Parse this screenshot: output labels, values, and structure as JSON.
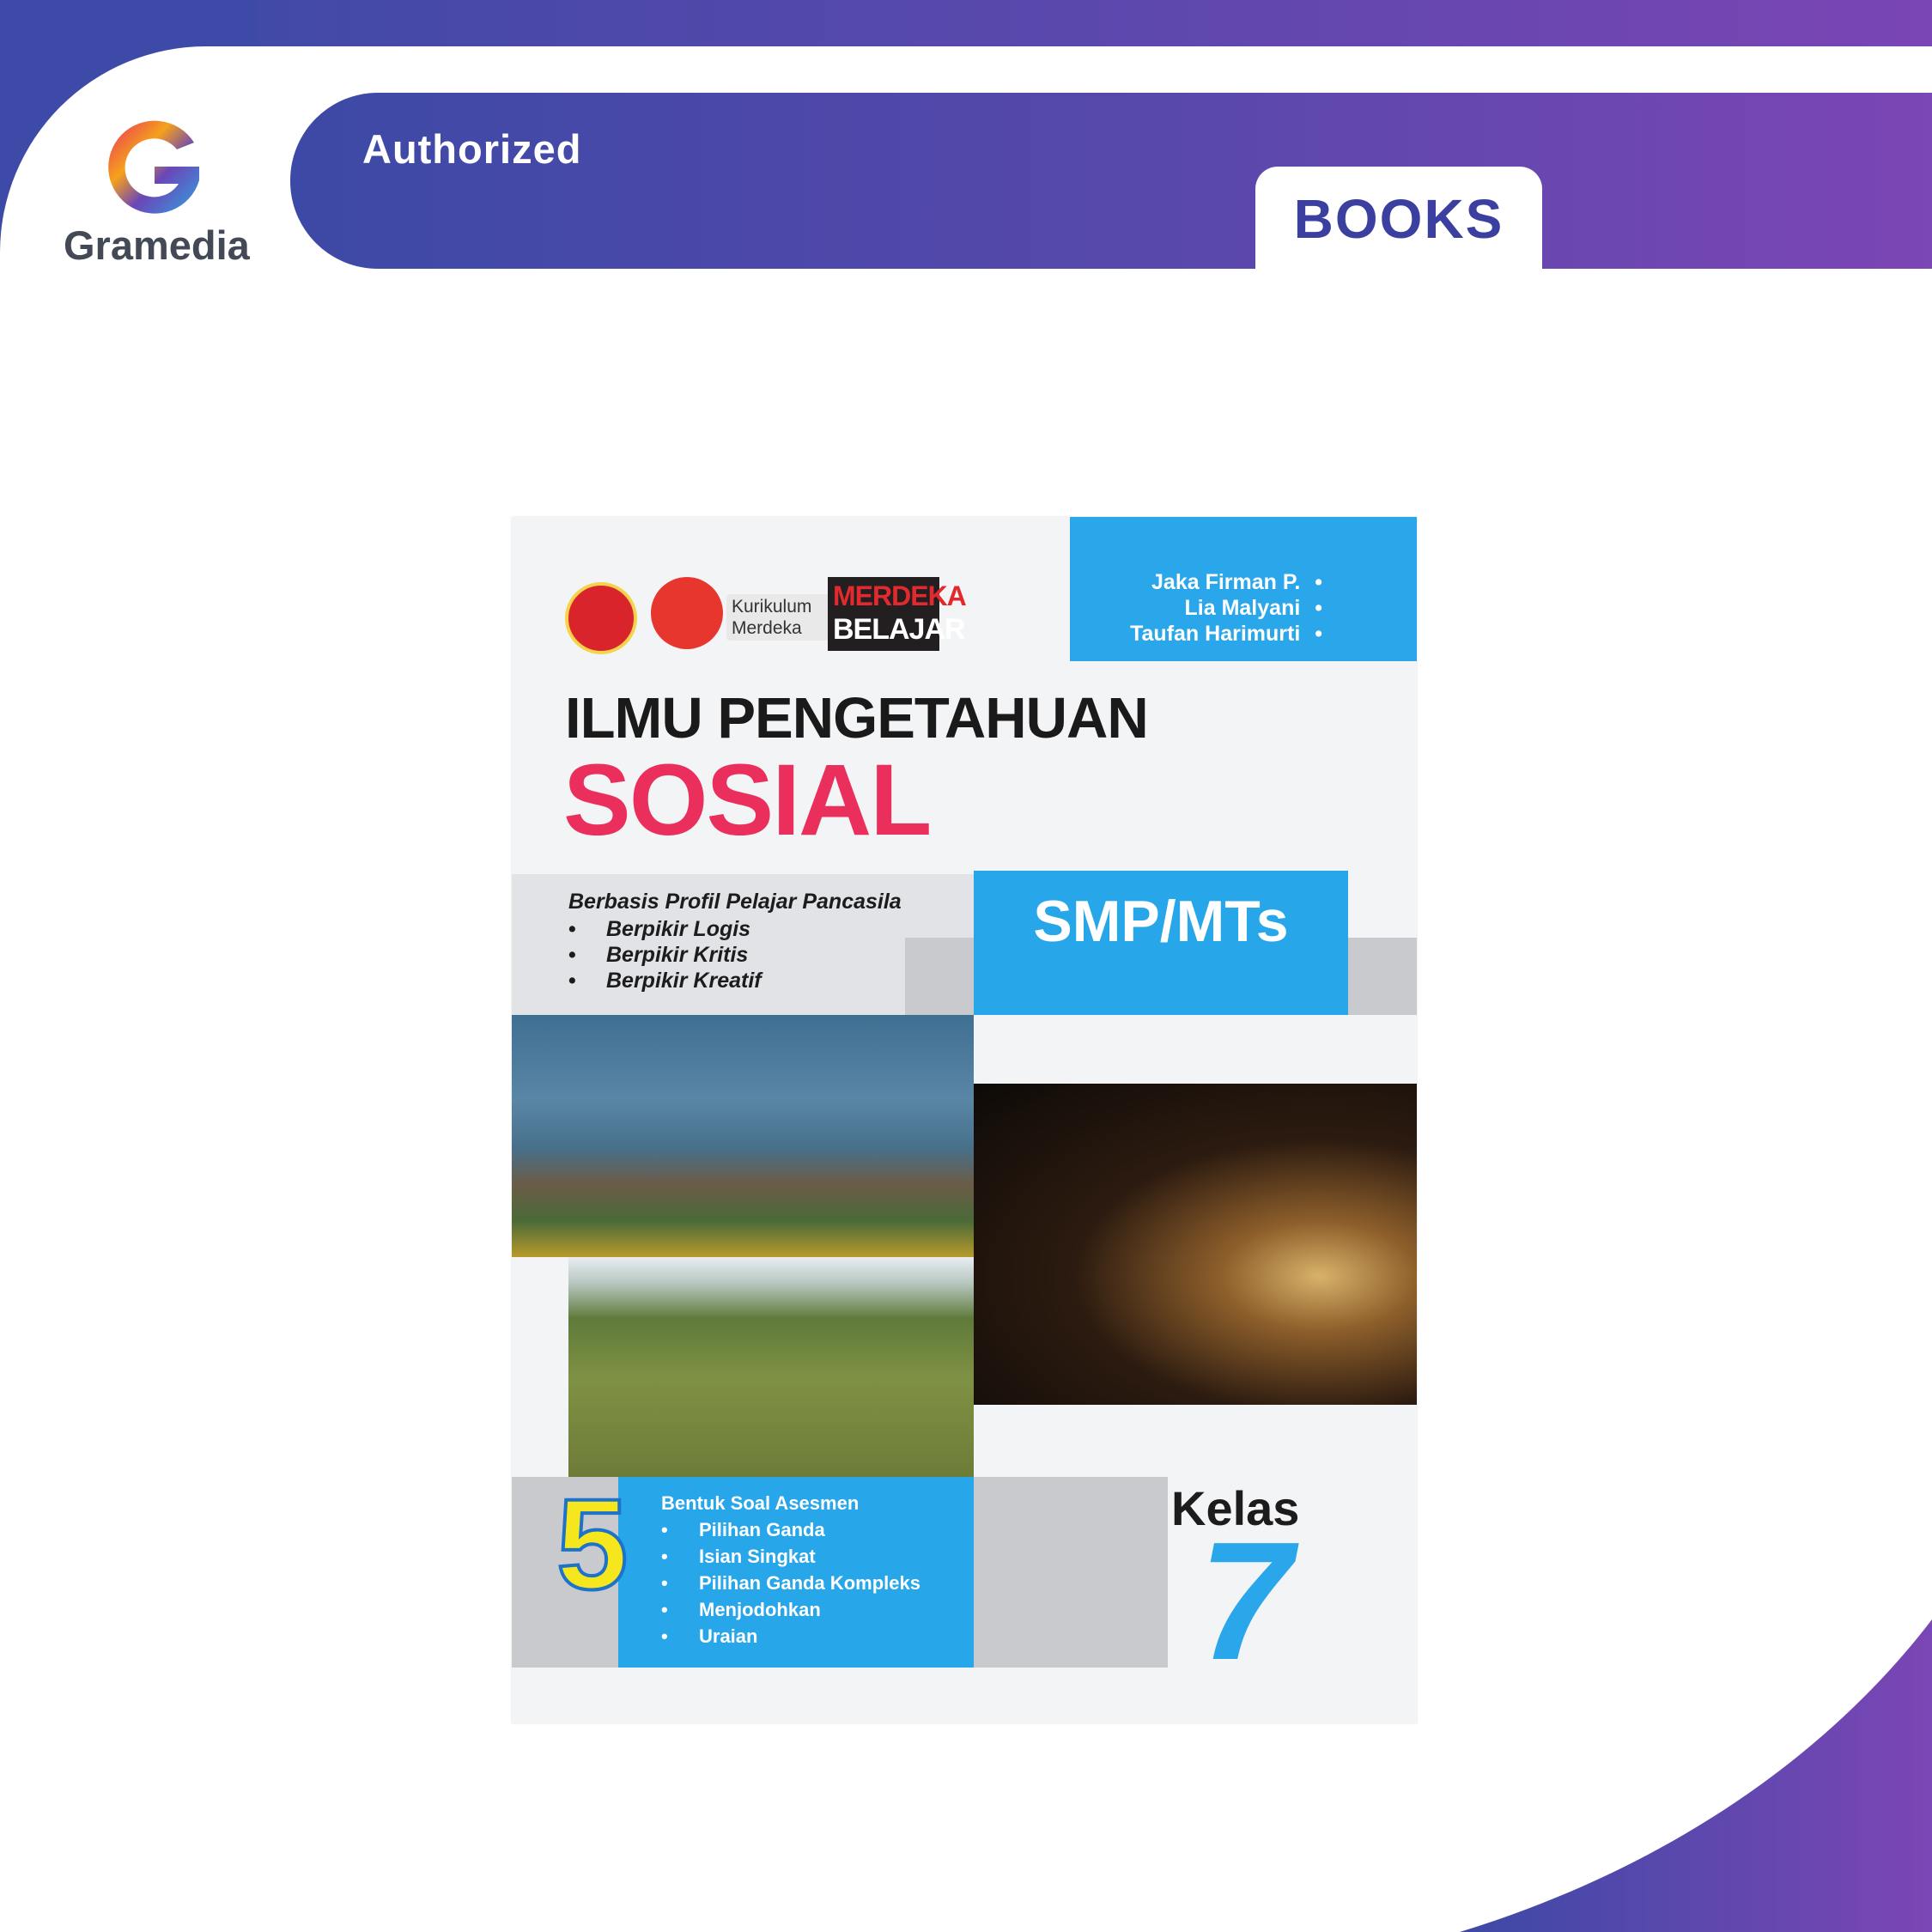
{
  "header": {
    "logo_name": "Gramedia",
    "authorized": "Authorized",
    "category_tab": "BOOKS"
  },
  "colors": {
    "brand_blue": "#3d49a6",
    "brand_purple": "#7b46b5",
    "cover_blue": "#28a6ea",
    "title_red": "#ea2f5d"
  },
  "book": {
    "authors": [
      "Jaka Firman P.",
      "Lia Malyani",
      "Taufan Harimurti"
    ],
    "author_bullet": "•",
    "badges": {
      "kurikulum_line1": "Kurikulum",
      "kurikulum_line2": "Merdeka",
      "merdeka": "MERDEKA",
      "belajar": "BELAJAR"
    },
    "title_line1": "ILMU PENGETAHUAN",
    "title_line2": "SOSIAL",
    "level": "SMP/MTs",
    "profile_title": "Berbasis Profil Pelajar Pancasila",
    "profile_items": [
      "Berpikir Logis",
      "Berpikir Kritis",
      "Berpikir Kreatif"
    ],
    "assessment_count": "5",
    "assessment_title": "Bentuk Soal Asesmen",
    "assessment_items": [
      "Pilihan Ganda",
      "Isian Singkat",
      "Pilihan Ganda Kompleks",
      "Menjodohkan",
      "Uraian"
    ],
    "kelas_label": "Kelas",
    "kelas_number": "7",
    "bullet": "•"
  }
}
